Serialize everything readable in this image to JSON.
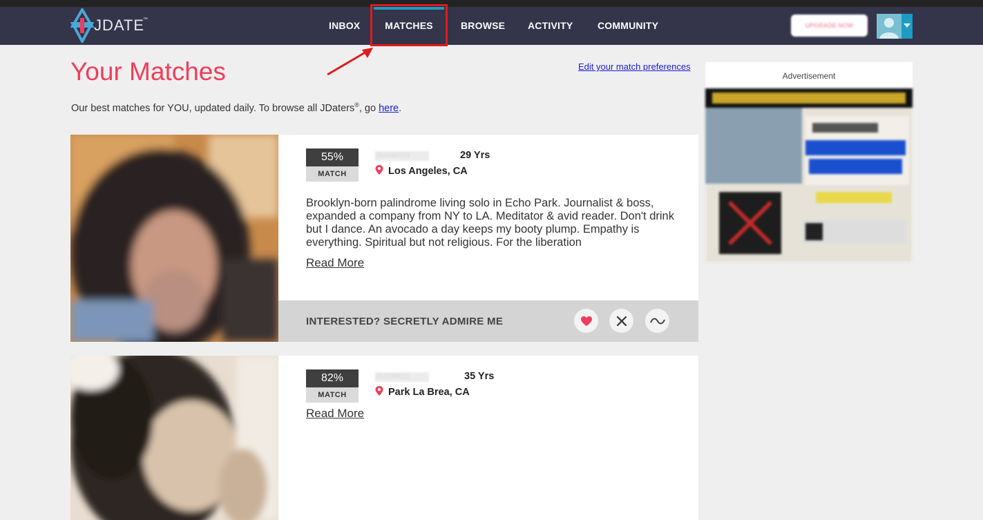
{
  "brand": {
    "name": "JDATE",
    "tm": "™"
  },
  "nav": {
    "items": [
      {
        "label": "INBOX"
      },
      {
        "label": "MATCHES"
      },
      {
        "label": "BROWSE"
      },
      {
        "label": "ACTIVITY"
      },
      {
        "label": "COMMUNITY"
      }
    ],
    "active": "MATCHES",
    "upgrade_label": "UPGRADE NOW",
    "accent_color": "#1e9bc2",
    "bar_color": "#34344a"
  },
  "page": {
    "title": "Your Matches",
    "subtitle_pre": "Our best matches for YOU, updated daily. To browse all JDaters",
    "subtitle_reg": "®",
    "subtitle_mid": ", go ",
    "subtitle_link": "here",
    "subtitle_post": ".",
    "pref_link": "Edit your match preferences",
    "title_color": "#ef3d5b"
  },
  "matches": [
    {
      "match_pct": "55%",
      "match_label": "MATCH",
      "username": "254098333",
      "age": "29 Yrs",
      "location": "Los Angeles, CA",
      "bio": "Brooklyn-born palindrome living solo in Echo Park. Journalist & boss, expanded a company from NY to LA. Meditator & avid reader. Don't drink but I dance. An avocado a day keeps my booty plump. Empathy is everything. Spiritual but not religious. For the liberation",
      "read_more": "Read More",
      "action_text": "INTERESTED? SECRETLY ADMIRE ME"
    },
    {
      "match_pct": "82%",
      "match_label": "MATCH",
      "username": "254299612",
      "age": "35 Yrs",
      "location": "Park La Brea, CA",
      "read_more": "Read More"
    }
  ],
  "ad": {
    "label": "Advertisement"
  },
  "icons": {
    "heart": "heart-icon",
    "close": "close-icon",
    "wave": "wave-icon",
    "pin": "location-pin-icon",
    "caret": "chevron-down-icon"
  }
}
